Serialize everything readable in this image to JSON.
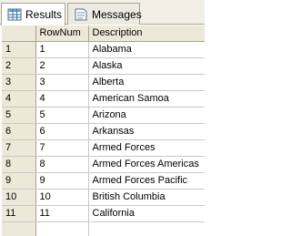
{
  "tabs": [
    {
      "label": "Results",
      "icon": "grid-icon",
      "active": true
    },
    {
      "label": "Messages",
      "icon": "messages-icon",
      "active": false
    }
  ],
  "grid": {
    "columns": [
      "",
      "RowNum",
      "Description"
    ],
    "rows": [
      {
        "n": "1",
        "rownum": "1",
        "description": "Alabama"
      },
      {
        "n": "2",
        "rownum": "2",
        "description": "Alaska"
      },
      {
        "n": "3",
        "rownum": "3",
        "description": "Alberta"
      },
      {
        "n": "4",
        "rownum": "4",
        "description": "American Samoa"
      },
      {
        "n": "5",
        "rownum": "5",
        "description": "Arizona"
      },
      {
        "n": "6",
        "rownum": "6",
        "description": "Arkansas"
      },
      {
        "n": "7",
        "rownum": "7",
        "description": "Armed Forces"
      },
      {
        "n": "8",
        "rownum": "8",
        "description": "Armed Forces Americas"
      },
      {
        "n": "9",
        "rownum": "9",
        "description": "Armed Forces Pacific"
      },
      {
        "n": "10",
        "rownum": "10",
        "description": "British Columbia"
      },
      {
        "n": "11",
        "rownum": "11",
        "description": "California"
      },
      {
        "n": "",
        "rownum": "",
        "description": ""
      }
    ]
  },
  "colors": {
    "header_bg": "#ece9d8",
    "grid_line": "#c9c9c9",
    "tab_bg": "#f2efe6"
  }
}
